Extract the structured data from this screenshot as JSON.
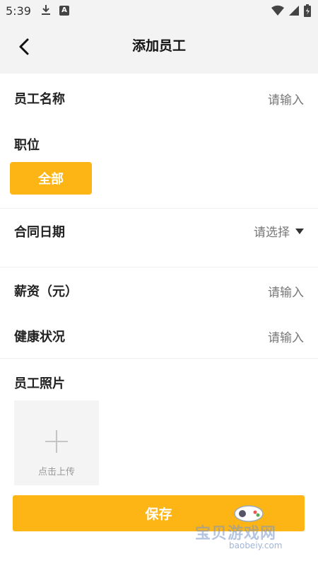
{
  "status_bar": {
    "time": "5:39",
    "notification_icon_letter": "A"
  },
  "header": {
    "title": "添加员工"
  },
  "form": {
    "employee_name": {
      "label": "员工名称",
      "placeholder": "请输入"
    },
    "position": {
      "label": "职位",
      "chip_label": "全部"
    },
    "contract_date": {
      "label": "合同日期",
      "placeholder": "请选择"
    },
    "salary": {
      "label": "薪资（元）",
      "placeholder": "请输入"
    },
    "health": {
      "label": "健康状况",
      "placeholder": "请输入"
    },
    "photo": {
      "label": "员工照片",
      "upload_label": "点击上传"
    }
  },
  "save_button": {
    "label": "保存"
  },
  "watermark": {
    "name": "宝贝游戏网",
    "url": "baobeiy.com"
  },
  "colors": {
    "accent": "#fdb515",
    "header_bg": "#f3f3f3",
    "placeholder": "#777777"
  },
  "icons": [
    "download-icon",
    "wifi-icon",
    "signal-icon",
    "battery-icon",
    "back-arrow-icon",
    "dropdown-triangle-icon",
    "plus-icon",
    "gamepad-icon"
  ]
}
